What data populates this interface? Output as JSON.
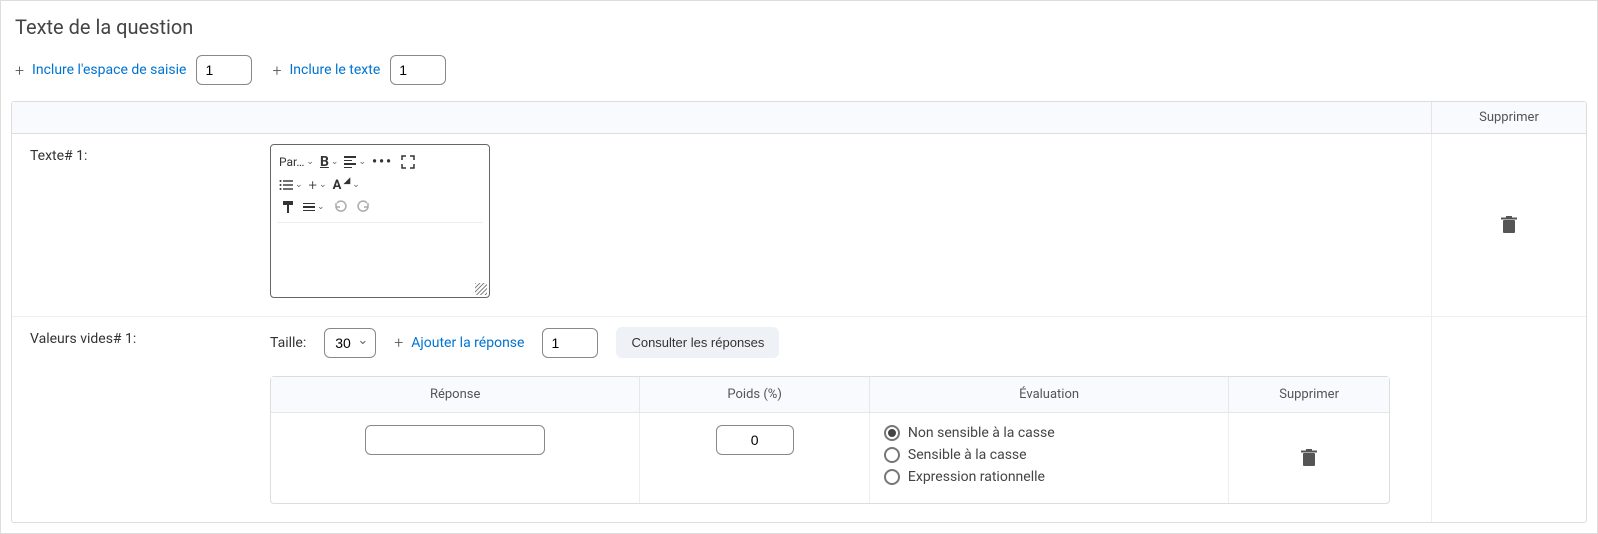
{
  "section": {
    "title": "Texte de la question"
  },
  "include": {
    "input_space": {
      "label": "Inclure l'espace de saisie",
      "value": "1"
    },
    "text": {
      "label": "Inclure le texte",
      "value": "1"
    }
  },
  "grid": {
    "header": {
      "supprimer": "Supprimer"
    },
    "text_block": {
      "label": "Texte# 1:",
      "toolbar": {
        "paragraph": "Par…",
        "bold": "B",
        "font_label": "A"
      }
    },
    "values_block": {
      "label": "Valeurs vides# 1:",
      "size_label": "Taille:",
      "size_value": "30",
      "add_answer": "Ajouter la réponse",
      "add_answer_value": "1",
      "view_answers": "Consulter les réponses",
      "answers_table": {
        "headers": {
          "reponse": "Réponse",
          "poids": "Poids (%)",
          "evaluation": "Évaluation",
          "supprimer": "Supprimer"
        },
        "row": {
          "reponse": "",
          "poids": "0",
          "evaluation": {
            "options": [
              "Non sensible à la casse",
              "Sensible à la casse",
              "Expression rationnelle"
            ],
            "selected_index": 0
          }
        }
      }
    }
  }
}
